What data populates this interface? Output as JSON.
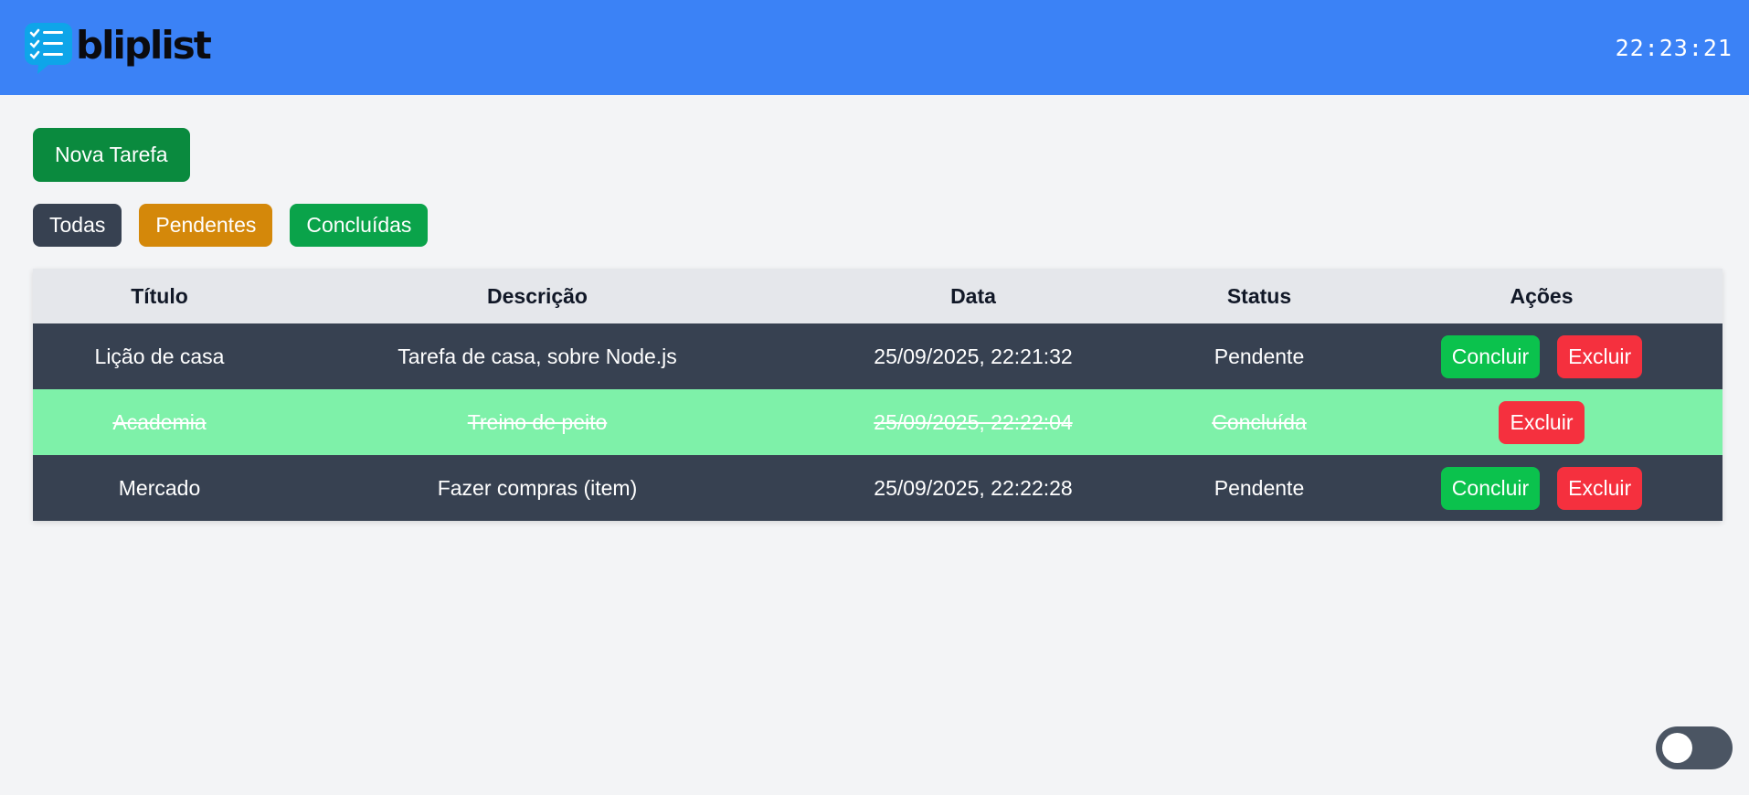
{
  "app": {
    "name": "bliplist",
    "clock": "22:23:21"
  },
  "actions": {
    "new_task": "Nova Tarefa"
  },
  "filters": [
    "Todas",
    "Pendentes",
    "Concluídas"
  ],
  "table": {
    "headers": [
      "Título",
      "Descrição",
      "Data",
      "Status",
      "Ações"
    ],
    "rows": [
      {
        "title": "Lição de casa",
        "description": "Tarefa de casa, sobre Node.js",
        "date": "25/09/2025, 22:21:32",
        "status": "Pendente",
        "complete_label": "Concluir",
        "delete_label": "Excluir"
      },
      {
        "title": "Academia",
        "description": "Treino de peito",
        "date": "25/09/2025, 22:22:04",
        "status": "Concluída",
        "delete_label": "Excluir"
      },
      {
        "title": "Mercado",
        "description": "Fazer compras (item)",
        "date": "25/09/2025, 22:22:28",
        "status": "Pendente",
        "complete_label": "Concluir",
        "delete_label": "Excluir"
      }
    ]
  },
  "colors": {
    "header": "#3b82f6",
    "pending_row": "#374151",
    "done_row": "#7ef1a9",
    "complete": "#0bc24d",
    "delete": "#f5303e"
  },
  "theme_toggle": {
    "on": false
  }
}
